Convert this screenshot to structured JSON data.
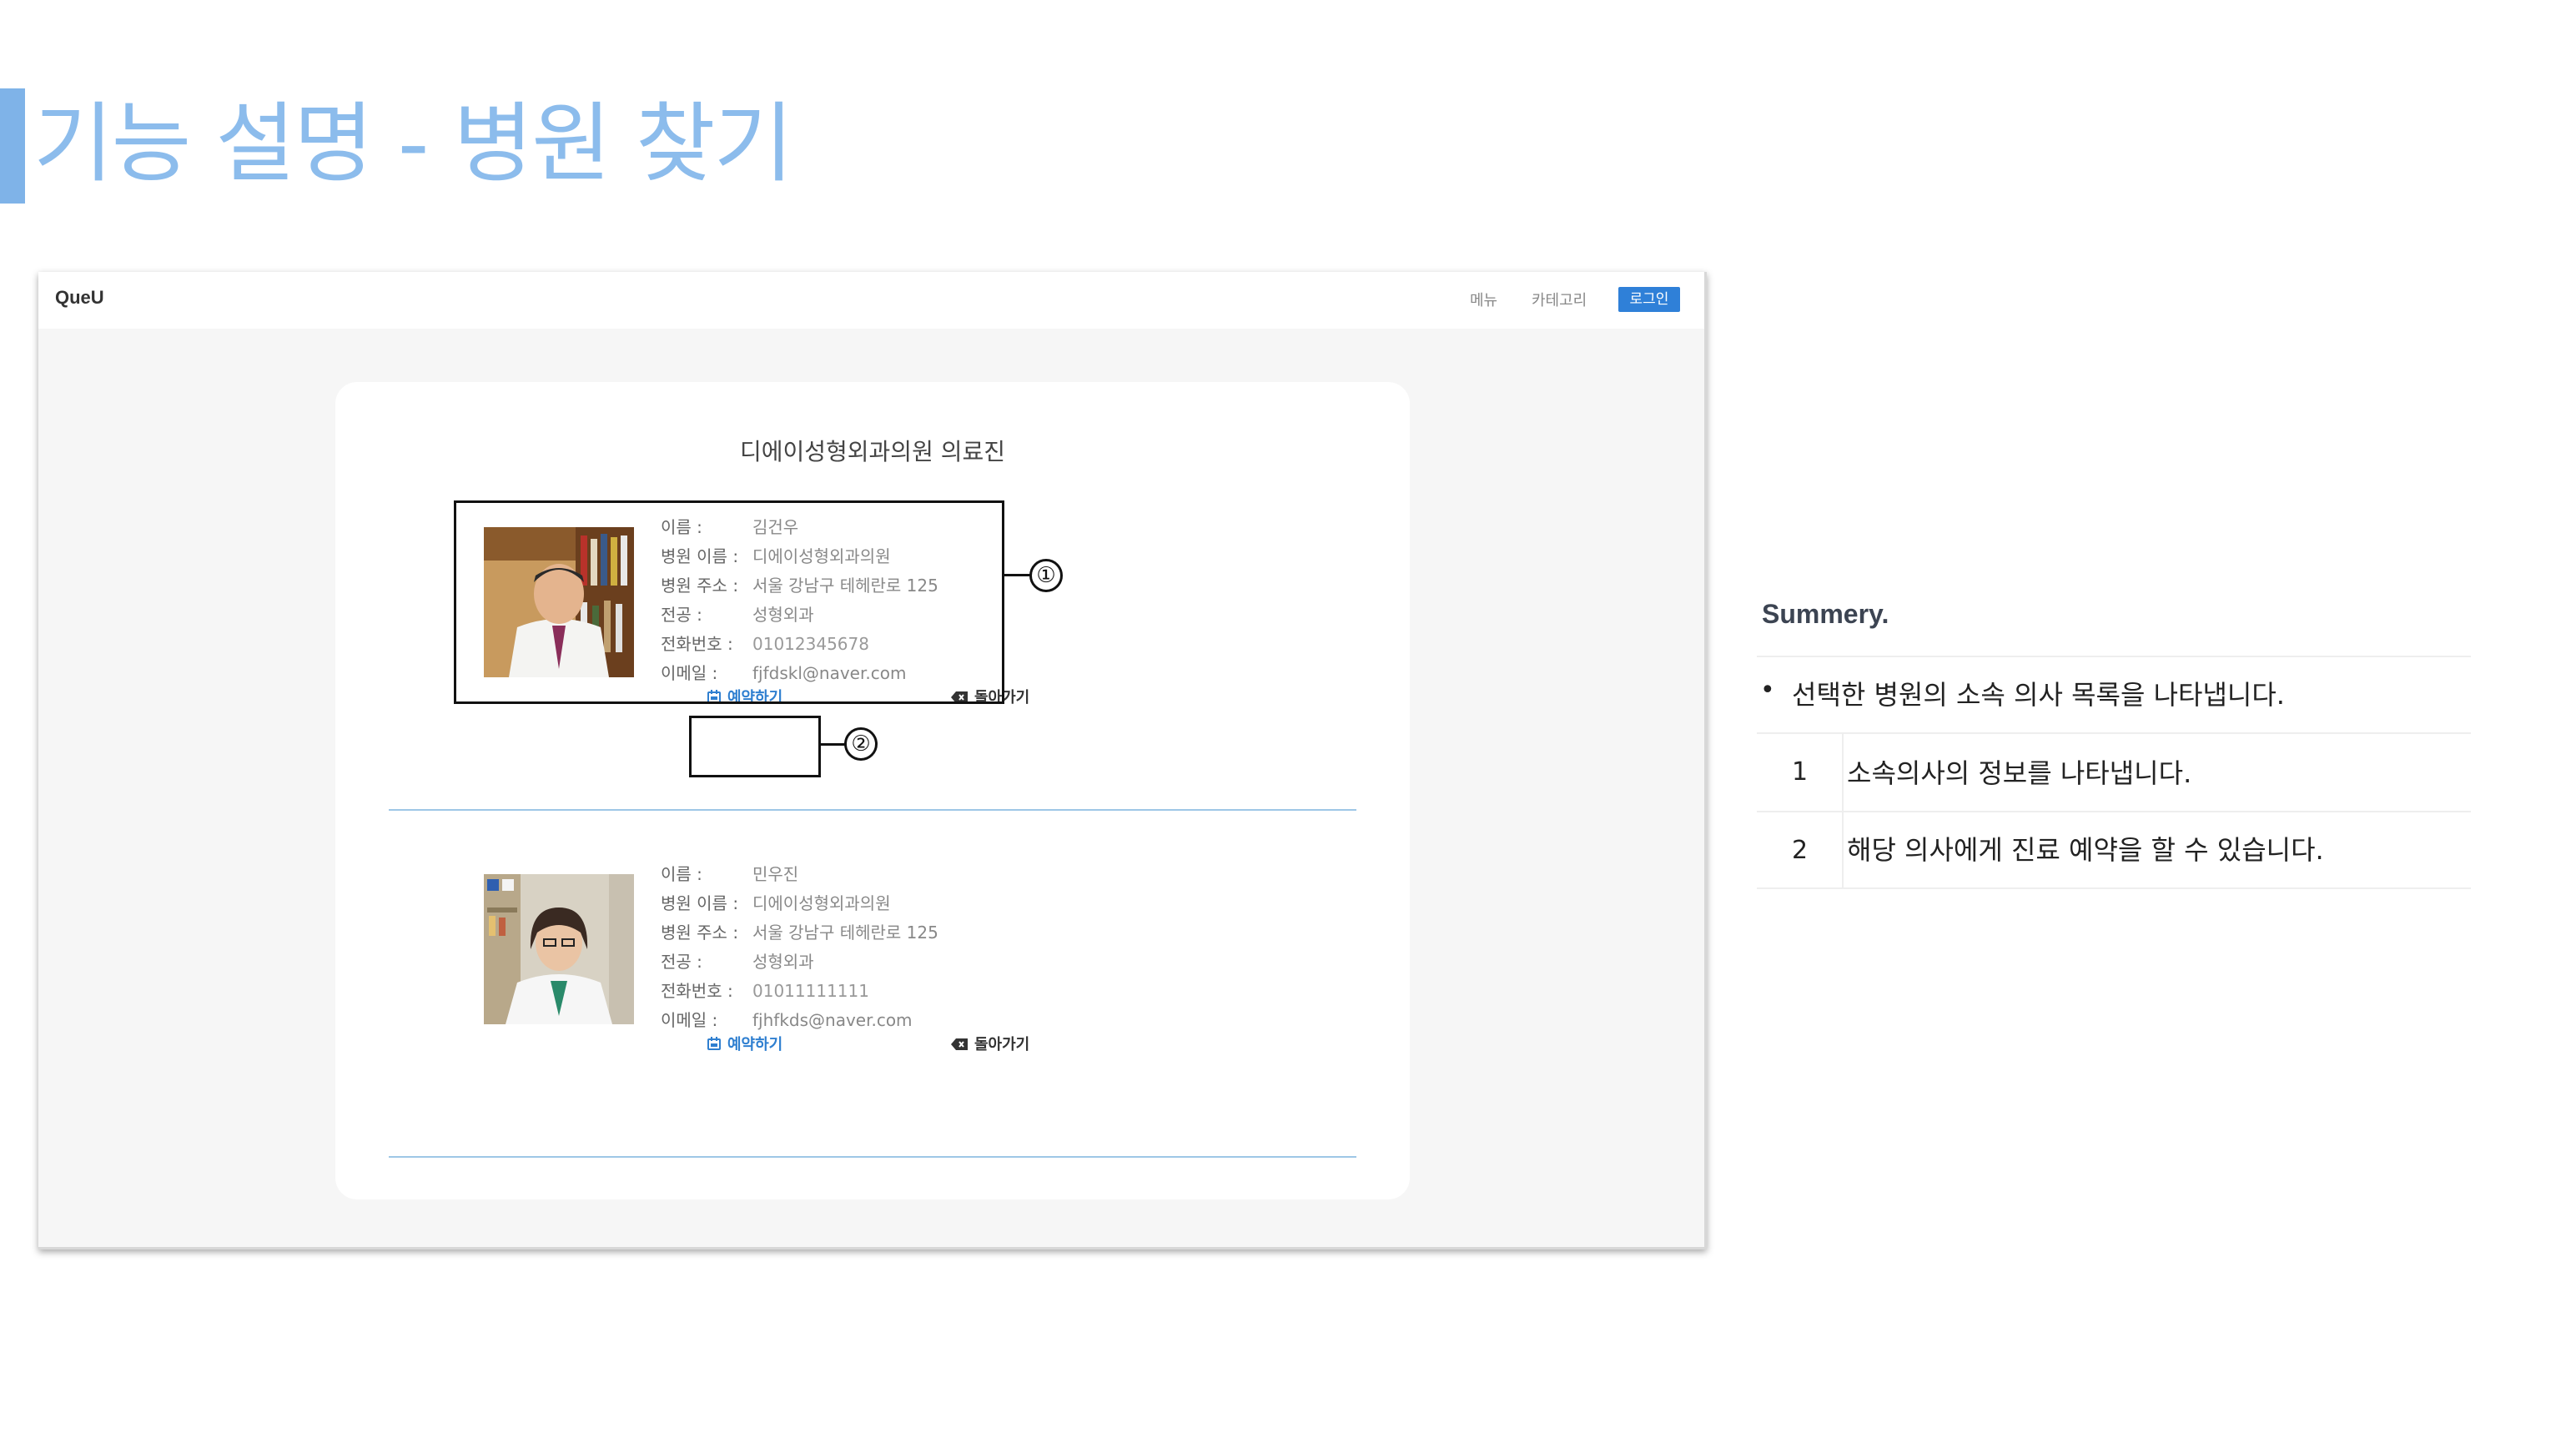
{
  "slide": {
    "title": "기능 설명 - 병원 찾기"
  },
  "app": {
    "brand": "QueU",
    "nav": {
      "menu": "메뉴",
      "category": "카테고리",
      "login": "로그인"
    }
  },
  "page": {
    "title": "디에이성형외과의원 의료진",
    "doctors": [
      {
        "labels": {
          "name": "이름 :",
          "hospital": "병원 이름 :",
          "address": "병원 주소 :",
          "major": "전공 :",
          "phone": "전화번호 :",
          "email": "이메일 :"
        },
        "name": "김건우",
        "hospital": "디에이성형외과의원",
        "address": "서울 강남구 테헤란로 125",
        "major": "성형외과",
        "phone": "01012345678",
        "email": "fjfdskl@naver.com",
        "reserve_label": "예약하기",
        "back_label": "돌아가기"
      },
      {
        "labels": {
          "name": "이름 :",
          "hospital": "병원 이름 :",
          "address": "병원 주소 :",
          "major": "전공 :",
          "phone": "전화번호 :",
          "email": "이메일 :"
        },
        "name": "민우진",
        "hospital": "디에이성형외과의원",
        "address": "서울 강남구 테헤란로 125",
        "major": "성형외과",
        "phone": "01011111111",
        "email": "fjhfkds@naver.com",
        "reserve_label": "예약하기",
        "back_label": "돌아가기"
      }
    ],
    "callouts": [
      "①",
      "②"
    ]
  },
  "summary": {
    "title": "Summery.",
    "bullet": "선택한 병원의 소속 의사 목록을 나타냅니다.",
    "items": [
      {
        "num": "1",
        "text": "소속의사의 정보를 나타냅니다."
      },
      {
        "num": "2",
        "text": "해당 의사에게 진료 예약을 할 수 있습니다."
      }
    ]
  },
  "colors": {
    "accent": "#7fb3e8",
    "title": "#8cbcec",
    "login": "#2f80d8",
    "link": "#2f7fd0",
    "divider": "#9ec7e6"
  }
}
